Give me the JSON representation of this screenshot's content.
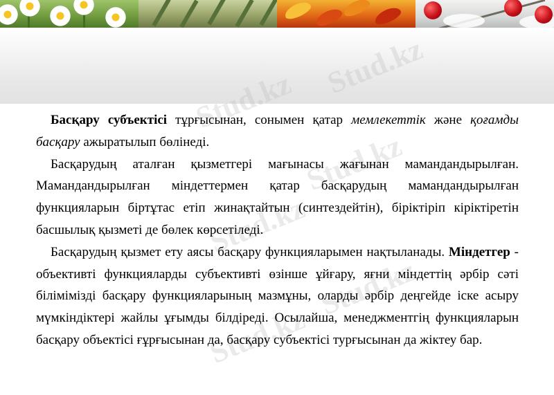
{
  "watermark": {
    "text": "Stud.kz"
  },
  "banner": {
    "seasons": [
      "spring",
      "summer",
      "autumn",
      "winter"
    ]
  },
  "body": {
    "p1": {
      "bold": "Басқару субъектісі",
      "t1": " тұрғысынан, сонымен қатар ",
      "i1": "мемлекеттік",
      "t2": " және ",
      "i2": "қоғамды басқару",
      "t3": " ажыратылып бөлінеді."
    },
    "p2": {
      "text": "Басқарудың аталған қызметгері мағынасы жағынан мамандандырылған. Мамандандырылған міндеттермен қатар басқарудың мамандандырылған функцияларын біртұтас етіп жинақтайтын (синтездейтін), біріктіріп кірiктiретін басшылық қызметі де бөлек көрсетіледі."
    },
    "p3": {
      "t1": "Басқарудың қызмет ету аясы басқару функцияларымен нақтыланады. ",
      "bold": "Міндетгер",
      "t2": " - объективті функцияларды субъективті өзінше ұйғару, яғни міндеттің әрбір сәті білімімізді басқару функцияларының мазмұны, оларды әрбір деңгейде іске асыру мүмкіндіктері жайлы ұғымды білдіреді. Осылайша, менеджментгің функцияларын басқару объектісі ғұрғысынан да, басқару субъектісі турғысынан да жіктеу бар."
    }
  }
}
